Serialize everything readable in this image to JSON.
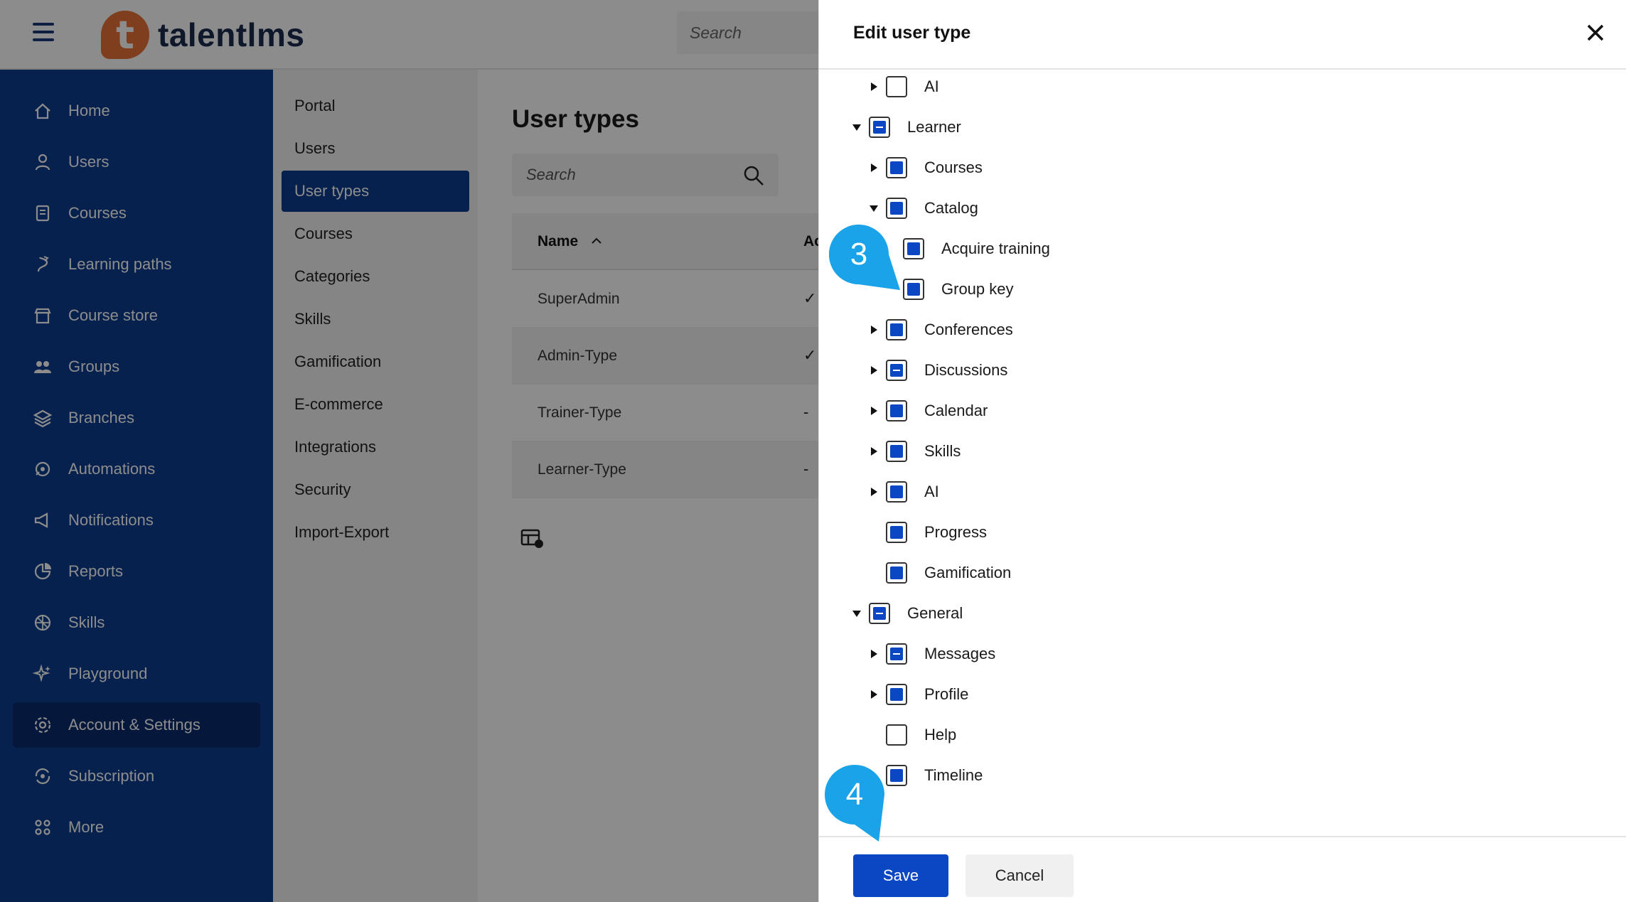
{
  "app": {
    "logo_mark": "t",
    "logo_text": "talentlms",
    "search_placeholder": "Search"
  },
  "sidebar": {
    "items": [
      {
        "label": "Home",
        "icon": "home-icon"
      },
      {
        "label": "Users",
        "icon": "user-icon"
      },
      {
        "label": "Courses",
        "icon": "book-icon"
      },
      {
        "label": "Learning paths",
        "icon": "path-icon"
      },
      {
        "label": "Course store",
        "icon": "store-icon"
      },
      {
        "label": "Groups",
        "icon": "groups-icon"
      },
      {
        "label": "Branches",
        "icon": "layers-icon"
      },
      {
        "label": "Automations",
        "icon": "automation-icon"
      },
      {
        "label": "Notifications",
        "icon": "megaphone-icon"
      },
      {
        "label": "Reports",
        "icon": "pie-chart-icon"
      },
      {
        "label": "Skills",
        "icon": "skills-icon"
      },
      {
        "label": "Playground",
        "icon": "sparkle-icon"
      },
      {
        "label": "Account & Settings",
        "icon": "gear-icon"
      },
      {
        "label": "Subscription",
        "icon": "subscription-icon"
      },
      {
        "label": "More",
        "icon": "grid-icon"
      }
    ]
  },
  "subnav": {
    "items": [
      "Portal",
      "Users",
      "User types",
      "Courses",
      "Categories",
      "Skills",
      "Gamification",
      "E-commerce",
      "Integrations",
      "Security",
      "Import-Export"
    ]
  },
  "main": {
    "title": "User types",
    "search_placeholder": "Search",
    "columns": {
      "name": "Name",
      "second": "Ac"
    },
    "rows": [
      {
        "name": "SuperAdmin",
        "mark": "✓"
      },
      {
        "name": "Admin-Type",
        "mark": "✓"
      },
      {
        "name": "Trainer-Type",
        "mark": "-"
      },
      {
        "name": "Learner-Type",
        "mark": "-"
      }
    ]
  },
  "drawer": {
    "title": "Edit user type",
    "tree": [
      {
        "label": "AI",
        "caret": "right",
        "state": "empty"
      },
      {
        "label": "Learner",
        "caret": "down",
        "state": "partial"
      },
      {
        "label": "Courses",
        "caret": "right",
        "state": "full"
      },
      {
        "label": "Catalog",
        "caret": "down",
        "state": "full"
      },
      {
        "label": "Acquire training",
        "caret": "none",
        "state": "full"
      },
      {
        "label": "Group key",
        "caret": "none",
        "state": "full"
      },
      {
        "label": "Conferences",
        "caret": "right",
        "state": "full"
      },
      {
        "label": "Discussions",
        "caret": "right",
        "state": "partial"
      },
      {
        "label": "Calendar",
        "caret": "right",
        "state": "full"
      },
      {
        "label": "Skills",
        "caret": "right",
        "state": "full"
      },
      {
        "label": "AI",
        "caret": "right",
        "state": "full"
      },
      {
        "label": "Progress",
        "caret": "none",
        "state": "full"
      },
      {
        "label": "Gamification",
        "caret": "none",
        "state": "full"
      },
      {
        "label": "General",
        "caret": "down",
        "state": "partial"
      },
      {
        "label": "Messages",
        "caret": "right",
        "state": "partial"
      },
      {
        "label": "Profile",
        "caret": "right",
        "state": "full"
      },
      {
        "label": "Help",
        "caret": "none",
        "state": "empty"
      },
      {
        "label": "Timeline",
        "caret": "none",
        "state": "full"
      }
    ],
    "save_label": "Save",
    "cancel_label": "Cancel"
  },
  "callouts": {
    "step3": "3",
    "step4": "4"
  },
  "colors": {
    "brand": "#0d3c8f",
    "primary": "#0b47c2",
    "logo": "#e8733a",
    "callout": "#1aa3e8"
  }
}
